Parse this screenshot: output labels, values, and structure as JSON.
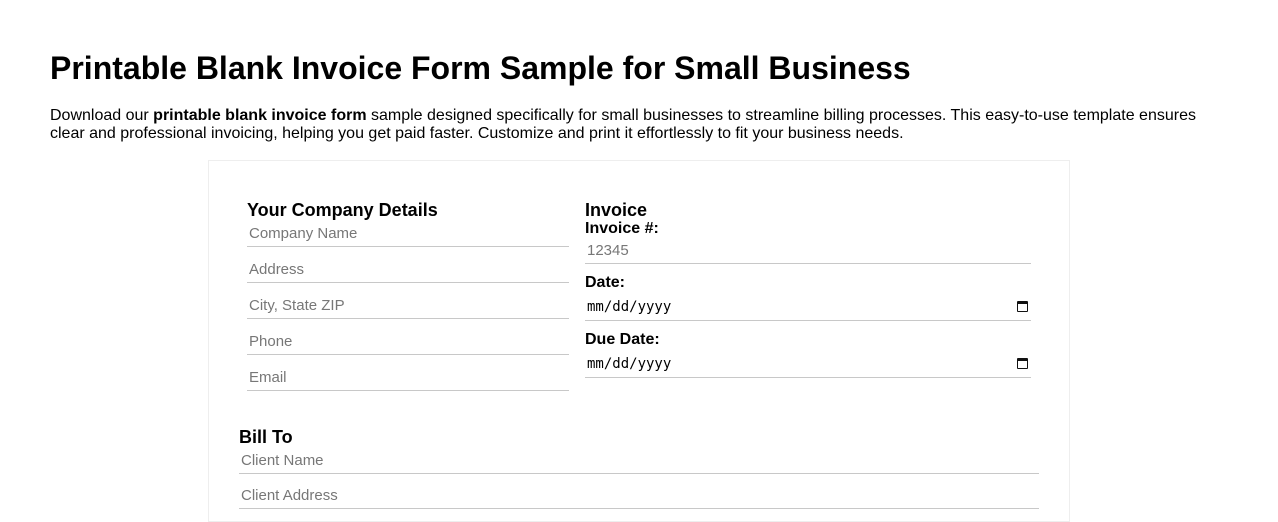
{
  "header": {
    "title": "Printable Blank Invoice Form Sample for Small Business",
    "intro_before": "Download our ",
    "intro_bold": "printable blank invoice form",
    "intro_after": " sample designed specifically for small businesses to streamline billing processes. This easy-to-use template ensures clear and professional invoicing, helping you get paid faster. Customize and print it effortlessly to fit your business needs."
  },
  "company": {
    "title": "Your Company Details",
    "fields": [
      {
        "placeholder": "Company Name"
      },
      {
        "placeholder": "Address"
      },
      {
        "placeholder": "City, State ZIP"
      },
      {
        "placeholder": "Phone"
      },
      {
        "placeholder": "Email"
      }
    ]
  },
  "invoice": {
    "title": "Invoice",
    "number_label": "Invoice #:",
    "number_placeholder": "12345",
    "date_label": "Date:",
    "date_placeholder": "mm/dd/yyyy",
    "due_label": "Due Date:",
    "due_placeholder": "mm/dd/yyyy",
    "calendar_icon": "calendar-icon"
  },
  "bill_to": {
    "title": "Bill To",
    "fields": [
      {
        "placeholder": "Client Name"
      },
      {
        "placeholder": "Client Address"
      }
    ]
  }
}
